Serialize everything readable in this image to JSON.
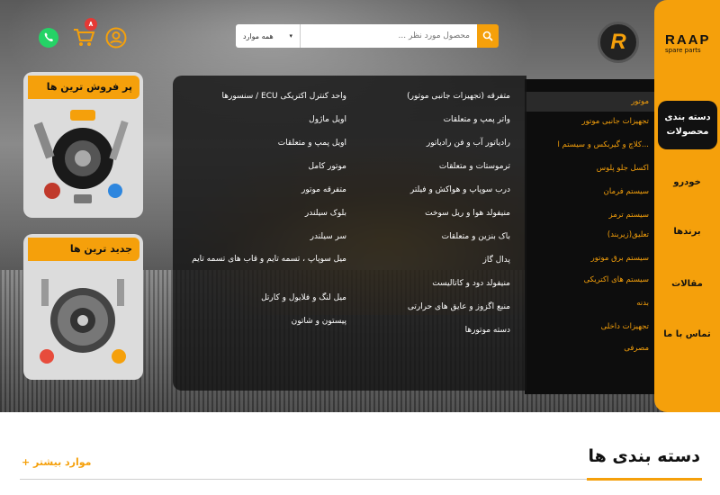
{
  "brand": {
    "name": "RAAP",
    "tagline": "spare parts",
    "mark": "R"
  },
  "search": {
    "placeholder": "محصول مورد نظر ...",
    "category": "همه موارد"
  },
  "cart": {
    "count": "۸"
  },
  "nav": {
    "categories": "دسته بندی محصولات",
    "items": [
      "خودرو",
      "برندها",
      "مقالات",
      "تماس با ما"
    ]
  },
  "categories": [
    "موتور",
    "تجهیزات جانبی موتور",
    "کلاچ و گیربکس و سیستم ا...",
    "اکسل جلو پلوس",
    "سیستم فرمان",
    "سیستم ترمز",
    "تعلیق(زیربند)",
    "سیستم برق موتور",
    "سیستم های اکتریکی",
    "بدنه",
    "تجهیزات داخلی",
    "مصرفی"
  ],
  "mega": {
    "col1": [
      "متفرقه (تجهیزات جانبی موتور)",
      "واتر پمپ و متعلقات",
      "رادیاتور آب و فن رادیاتور",
      "ترموستات و متعلقات",
      "درب سوپاپ و هواکش و فیلتر",
      "منیفولد هوا و ریل سوخت",
      "باک بنزین و متعلقات",
      "پدال گاز",
      "منیفولد دود و کاتالیست",
      "منبع اگزوز و عایق های حرارتی",
      "دسته موتورها"
    ],
    "col2": [
      "واحد کنترل اکتریکی ECU / سنسورها",
      "اویل ماژول",
      "اویل پمپ و متعلقات",
      "موتور کامل",
      "متفرقه موتور",
      "بلوک سیلندر",
      "سر سیلندر",
      "میل سوپاپ ، تسمه تایم و قاب های تسمه تایم",
      "میل لنگ و فلایول و کارتل",
      "پیستون و شاتون"
    ]
  },
  "cards": {
    "best": "پر فروش ترین ها",
    "newest": "جدید ترین ها"
  },
  "section": {
    "title": "دسته بندی ها",
    "more": "+ موارد بیشتر"
  },
  "colors": {
    "accent": "#f5a00b",
    "dark": "#0d0d0d",
    "badge": "#e53935",
    "whatsapp": "#25d366"
  }
}
